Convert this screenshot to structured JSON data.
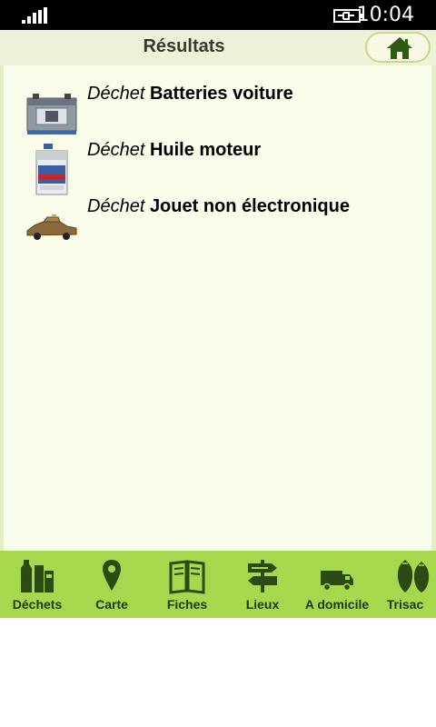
{
  "status": {
    "time": "10:04"
  },
  "header": {
    "title": "Résultats"
  },
  "results": [
    {
      "prefix": "Déchet",
      "name": "Batteries voiture",
      "icon": "car-battery-icon"
    },
    {
      "prefix": "Déchet",
      "name": "Huile moteur",
      "icon": "motor-oil-icon"
    },
    {
      "prefix": "Déchet",
      "name": "Jouet non électronique",
      "icon": "toy-car-icon"
    }
  ],
  "tabs": [
    {
      "label": "Déchets",
      "icon": "bottles-icon"
    },
    {
      "label": "Carte",
      "icon": "map-pin-icon"
    },
    {
      "label": "Fiches",
      "icon": "book-icon"
    },
    {
      "label": "Lieux",
      "icon": "signpost-icon"
    },
    {
      "label": "A domicile",
      "icon": "truck-icon"
    },
    {
      "label": "Trisac",
      "icon": "trash-bags-icon"
    }
  ],
  "colors": {
    "accent": "#a6d84e",
    "header": "#ecf3d8",
    "content": "#fafde9",
    "icon": "#2c4a14"
  }
}
